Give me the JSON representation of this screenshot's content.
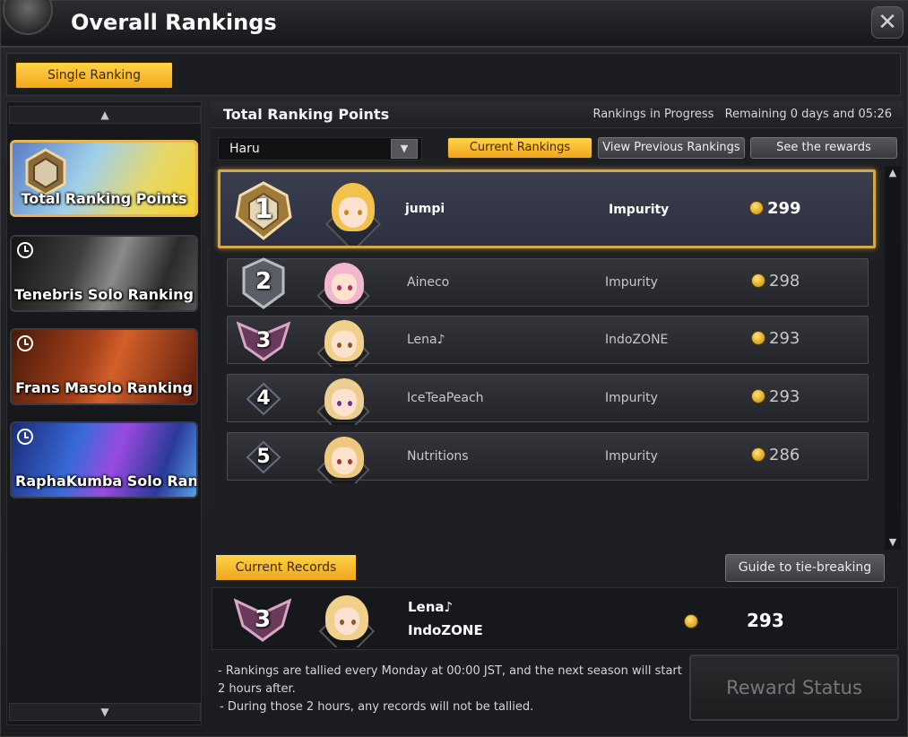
{
  "window": {
    "title": "Overall Rankings",
    "close_icon": "close-icon"
  },
  "tabs": {
    "active_label": "Single Ranking"
  },
  "sidebar": {
    "items": [
      {
        "label": "Total Ranking Points",
        "icon": "medal-icon",
        "active": true
      },
      {
        "label": "Tenebris Solo Ranking",
        "icon": "clock-icon",
        "active": false
      },
      {
        "label": "Frans Masolo Ranking",
        "icon": "clock-icon",
        "active": false
      },
      {
        "label": "RaphaKumba Solo Rank",
        "icon": "clock-icon",
        "active": false
      }
    ]
  },
  "main": {
    "title": "Total Ranking Points",
    "status": "Rankings in Progress",
    "remaining": "Remaining 0 days and 05:26",
    "server_filter": "Haru",
    "buttons": {
      "current": "Current Rankings",
      "previous": "View Previous Rankings",
      "rewards": "See the rewards"
    },
    "rankings": [
      {
        "rank": "1",
        "name": "jumpi",
        "guild": "Impurity",
        "points": "299"
      },
      {
        "rank": "2",
        "name": "Aineco",
        "guild": "Impurity",
        "points": "298"
      },
      {
        "rank": "3",
        "name": "Lena♪",
        "guild": "IndoZONE",
        "points": "293"
      },
      {
        "rank": "4",
        "name": "IceTeaPeach",
        "guild": "Impurity",
        "points": "293"
      },
      {
        "rank": "5",
        "name": "Nutritions",
        "guild": "Impurity",
        "points": "286"
      }
    ]
  },
  "records": {
    "tab_label": "Current Records",
    "guide_label": "Guide to tie-breaking",
    "rank": "3",
    "name": "Lena♪",
    "guild": "IndoZONE",
    "points": "293"
  },
  "notes": {
    "line1": "- Rankings are tallied every Monday at 00:00 JST, and the next season will start 2 hours after.",
    "line2": "- During those 2 hours, any records will not be tallied."
  },
  "reward_status_label": "Reward Status",
  "colors": {
    "accent": "#f3b02a",
    "gold_border": "#d9a646",
    "panel": "#1e1f23"
  }
}
